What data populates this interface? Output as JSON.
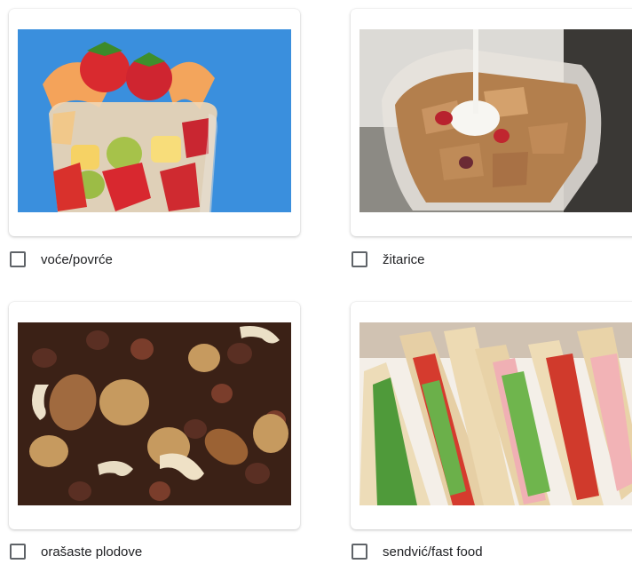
{
  "options": [
    {
      "label": "voće/povrće",
      "image_icon": "fruit-salad-icon",
      "checked": false
    },
    {
      "label": "žitarice",
      "image_icon": "cereal-bowl-icon",
      "checked": false
    },
    {
      "label": "orašaste plodove",
      "image_icon": "mixed-nuts-icon",
      "checked": false
    },
    {
      "label": "sendvić/fast food",
      "image_icon": "sandwich-icon",
      "checked": false
    }
  ],
  "colors": {
    "fruit_bg": "#3a8fdd",
    "checkbox_border": "#5f6368",
    "text": "#202124"
  }
}
